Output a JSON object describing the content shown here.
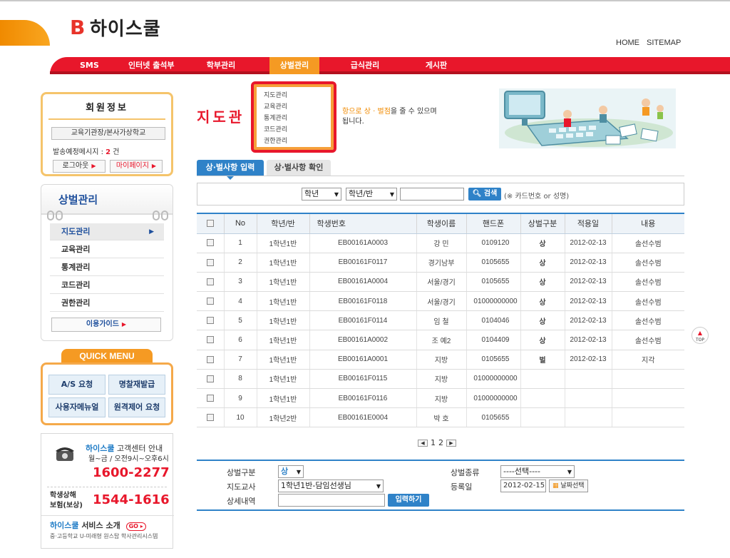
{
  "brand": {
    "logo_text": "하이스쿨",
    "logo_mark": "B"
  },
  "top_links": [
    "HOME",
    "SITEMAP"
  ],
  "nav": {
    "items": [
      "SMS",
      "인터넷 출석부",
      "학부관리",
      "상벌관리",
      "급식관리",
      "게시판"
    ],
    "active": "상벌관리"
  },
  "dropdown": {
    "items": [
      "지도관리",
      "교육관리",
      "통계관리",
      "코드관리",
      "권한관리"
    ]
  },
  "member": {
    "title": "회원정보",
    "org": "교육기관장/본사가상학교",
    "notice_label": "발송예정메시지 :",
    "notice_count": "2",
    "notice_unit": "건",
    "logout": "로그아웃",
    "mypage": "마이페이지"
  },
  "side_menu": {
    "title": "상벌관리",
    "items": [
      "지도관리",
      "교육관리",
      "통계관리",
      "코드관리",
      "권한관리"
    ],
    "active_index": 0,
    "guide": "이용가이드"
  },
  "quick_menu": {
    "label": "QUICK MENU",
    "buttons": [
      "A/S 요청",
      "명찰재발급",
      "사용자메뉴얼",
      "원격제어 요청"
    ]
  },
  "support": {
    "brand": "하이스쿨",
    "title_rest": " 고객센터 안내",
    "hours": "월~금 / 오전9시~오후6시",
    "phone": "1600-2277",
    "insurance_label_1": "학생상해",
    "insurance_label_2": "보험(보상)",
    "insurance_phone": "1544-1616",
    "service_brand": "하이스쿨",
    "service_rest": " 서비스 소개",
    "go": "GO",
    "service_sub": "중·고등학교 U-미래형 원스탑 학사관리시스템"
  },
  "page": {
    "title": "지도관",
    "desc_hl": "항으로 상 · 벌점",
    "desc_rest": "을 줄 수 있으며",
    "desc_line2": "됩니다."
  },
  "tabs": {
    "active": "상·벌사항 입력",
    "other": "상·벌사항 확인"
  },
  "search": {
    "grade_select": "학년",
    "class_select": "학년/반",
    "input_value": "",
    "button": "검색",
    "hint": "(※ 카드번호 or 성명)"
  },
  "table": {
    "headers": [
      "No",
      "학년/반",
      "학생번호",
      "학생이름",
      "핸드폰",
      "상벌구분",
      "적용일",
      "내용"
    ],
    "rows": [
      [
        "1",
        "1학년1반",
        "EB00161A0003",
        "강  민",
        "0109120",
        "상",
        "2012-02-13",
        "솔선수범"
      ],
      [
        "2",
        "1학년1반",
        "EB00161F0117",
        "경기남부",
        "0105655",
        "상",
        "2012-02-13",
        "솔선수범"
      ],
      [
        "3",
        "1학년1반",
        "EB00161A0004",
        "서울/경기",
        "0105655",
        "상",
        "2012-02-13",
        "솔선수범"
      ],
      [
        "4",
        "1학년1반",
        "EB00161F0118",
        "서울/경기",
        "01000000000",
        "상",
        "2012-02-13",
        "솔선수범"
      ],
      [
        "5",
        "1학년1반",
        "EB00161F0114",
        "임  철",
        "0104046",
        "상",
        "2012-02-13",
        "솔선수범"
      ],
      [
        "6",
        "1학년1반",
        "EB00161A0002",
        "조  예2",
        "0104409",
        "상",
        "2012-02-13",
        "솔선수범"
      ],
      [
        "7",
        "1학년1반",
        "EB00161A0001",
        "지방",
        "0105655",
        "벌",
        "2012-02-13",
        "지각"
      ],
      [
        "8",
        "1학년1반",
        "EB00161F0115",
        "지방",
        "01000000000",
        "",
        "",
        ""
      ],
      [
        "9",
        "1학년1반",
        "EB00161F0116",
        "지방",
        "01000000000",
        "",
        "",
        ""
      ],
      [
        "10",
        "1학년2반",
        "EB00161E0004",
        "박  호",
        "0105655",
        "",
        "",
        ""
      ]
    ]
  },
  "pager": {
    "pages": [
      "1",
      "2"
    ]
  },
  "form": {
    "type_label": "상벌구분",
    "type_value": "상",
    "kind_label": "상벌종류",
    "kind_value": "----선택----",
    "teacher_label": "지도교사",
    "teacher_value": "1학년1반-담임선생님",
    "date_label": "등록일",
    "date_value": "2012-02-15",
    "date_btn": "날짜선택",
    "detail_label": "상세내역",
    "detail_value": "",
    "submit": "입력하기"
  },
  "top_button": "TOP",
  "colors": {
    "brand_red": "#e8172b",
    "brand_orange": "#f59a23",
    "accent_blue": "#2f82c8"
  }
}
